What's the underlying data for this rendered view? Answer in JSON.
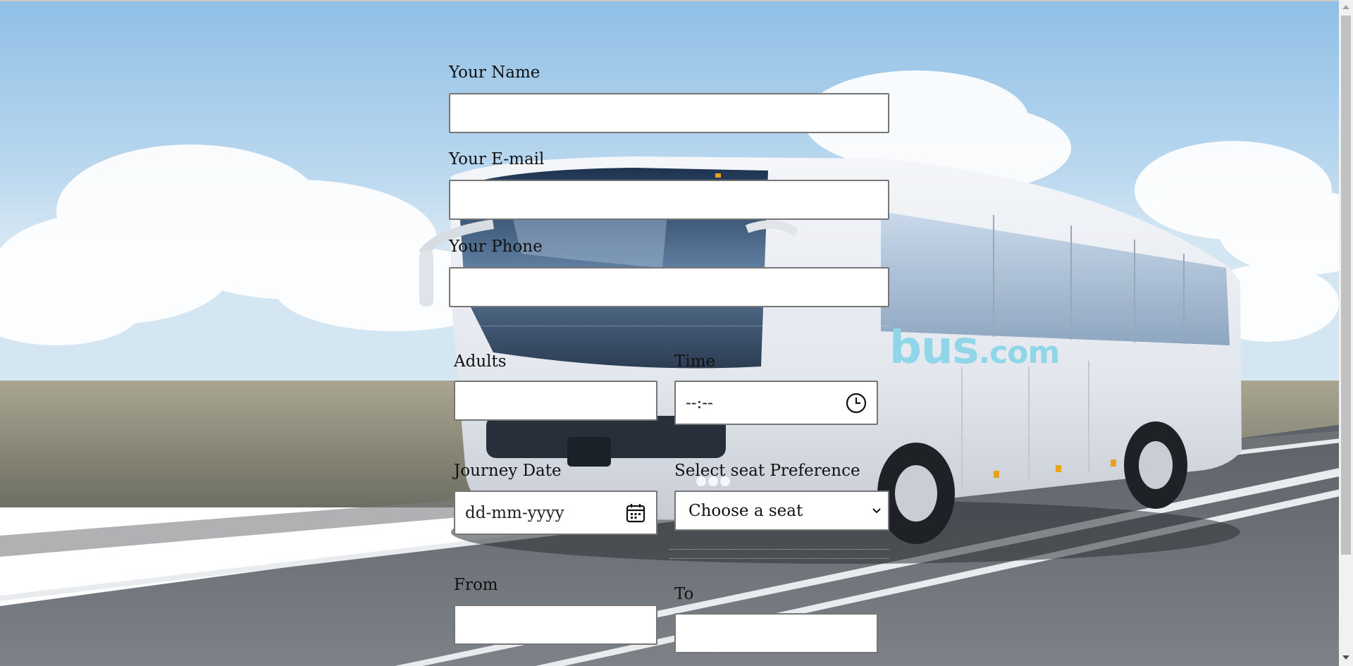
{
  "form": {
    "name_label": "Your Name",
    "name_value": "",
    "email_label": "Your E-mail",
    "email_value": "",
    "phone_label": "Your Phone",
    "phone_value": "",
    "adults_label": "Adults",
    "adults_value": "",
    "time_label": "Time",
    "time_placeholder": "--:--",
    "journey_date_label": "Journey Date",
    "journey_date_placeholder": "dd-mm-yyyy",
    "seat_label": "Select seat Preference",
    "seat_selected": "Choose a seat",
    "from_label": "From",
    "from_value": "",
    "to_label": "To",
    "to_value": ""
  },
  "background": {
    "bus_logo_main": "bus",
    "bus_logo_suffix": ".com",
    "logo_color": "#8fd6e8",
    "sky_color": "#a9cde9",
    "road_color": "#6f747a"
  },
  "icons": {
    "time": "clock-icon",
    "date": "calendar-icon",
    "select": "chevron-down-icon"
  }
}
